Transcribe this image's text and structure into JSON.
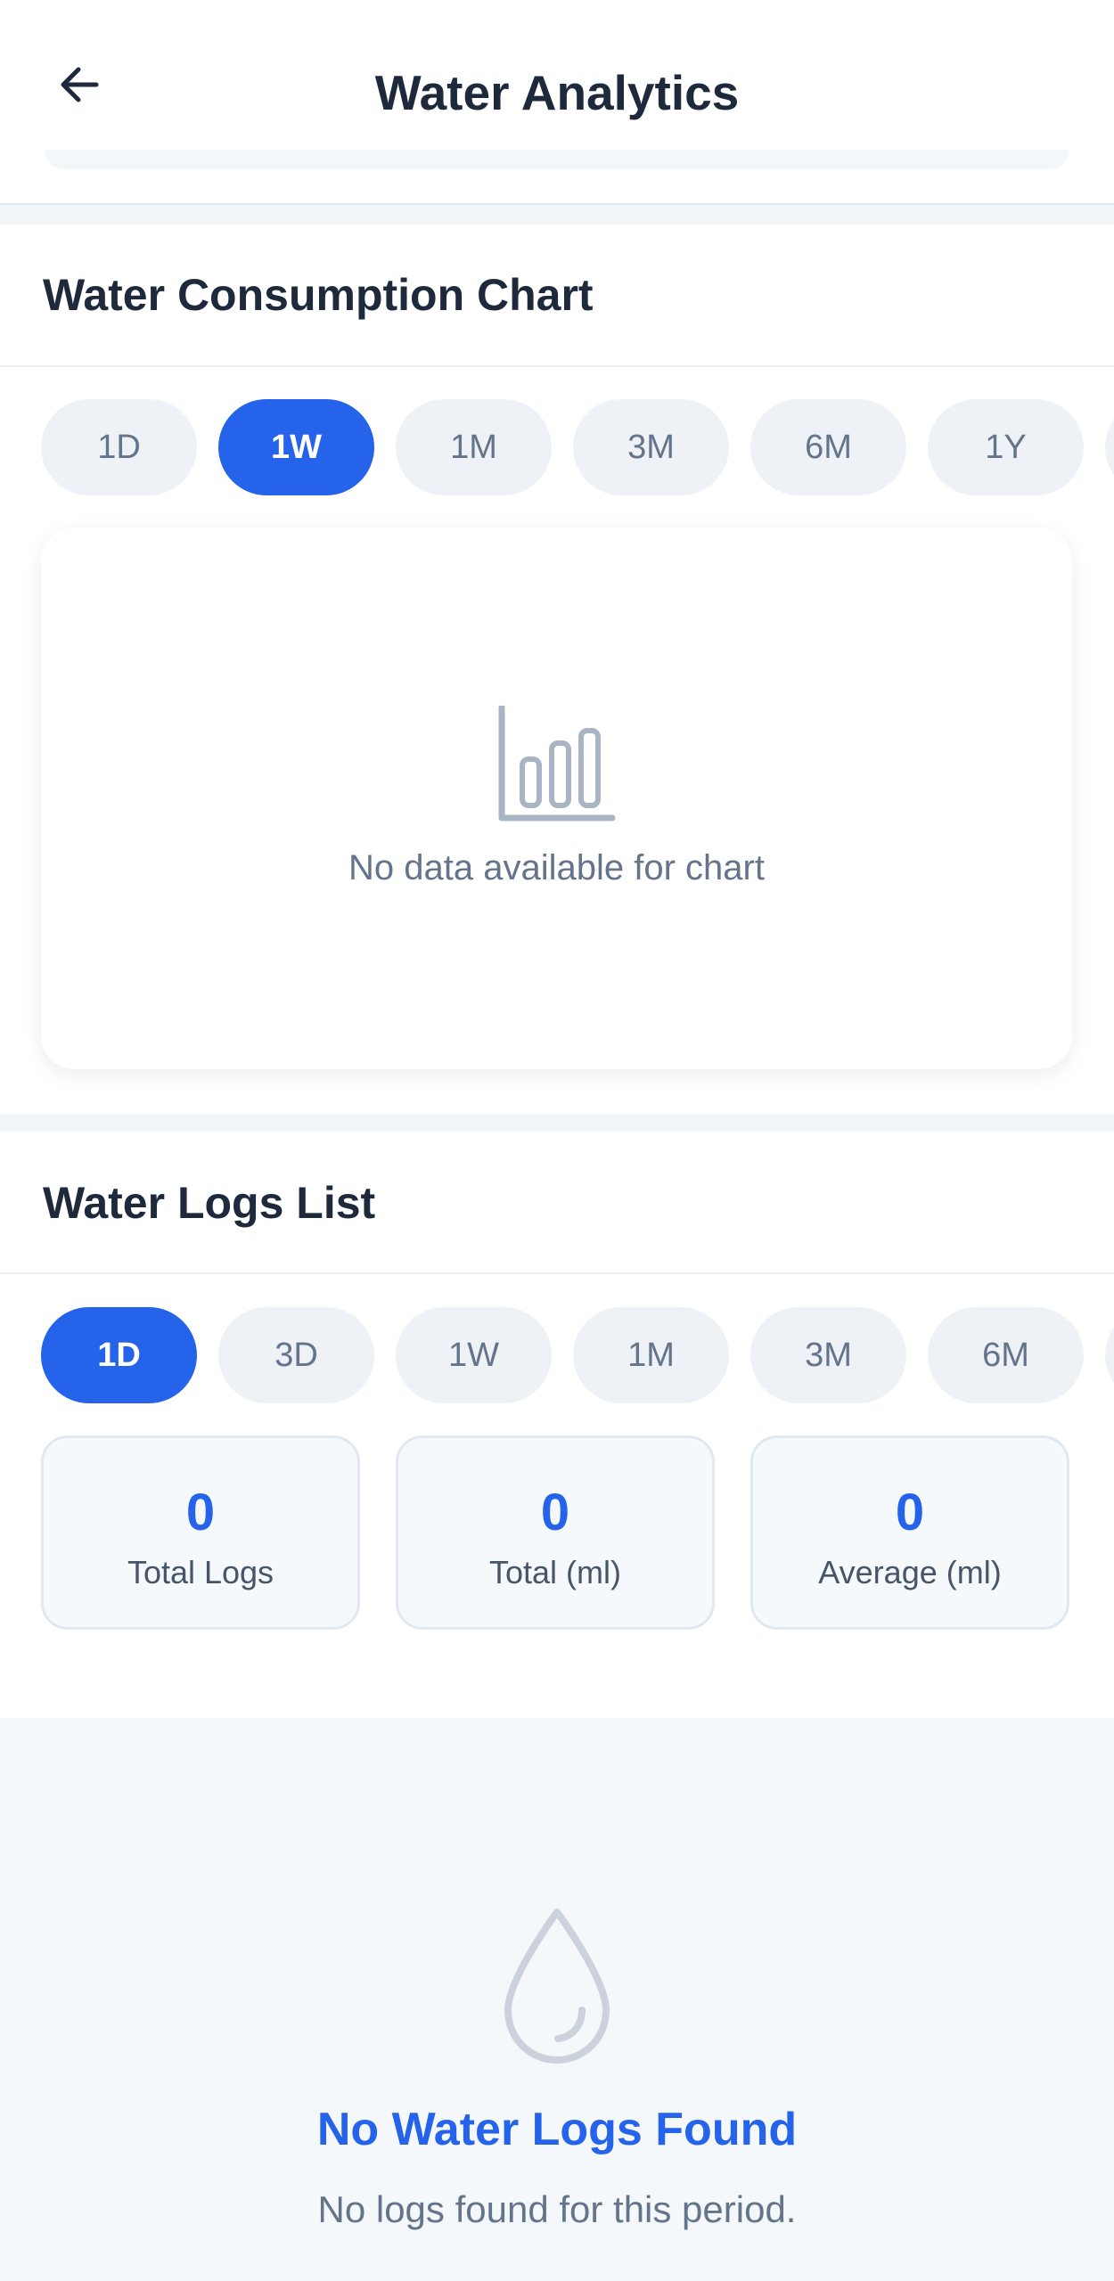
{
  "header": {
    "title": "Water Analytics",
    "back_icon": "arrow-left-icon"
  },
  "chart_section": {
    "title": "Water Consumption Chart",
    "ranges": [
      "1D",
      "1W",
      "1M",
      "3M",
      "6M",
      "1Y"
    ],
    "selected_range": "1W",
    "empty_icon": "bar-chart-icon",
    "empty_text": "No data available for chart"
  },
  "logs_section": {
    "title": "Water Logs List",
    "ranges": [
      "1D",
      "3D",
      "1W",
      "1M",
      "3M",
      "6M"
    ],
    "selected_range": "1D",
    "stats": [
      {
        "value": "0",
        "label": "Total Logs"
      },
      {
        "value": "0",
        "label": "Total (ml)"
      },
      {
        "value": "0",
        "label": "Average (ml)"
      }
    ]
  },
  "empty_state": {
    "icon": "water-drop-icon",
    "title": "No Water Logs Found",
    "subtitle": "No logs found for this period."
  },
  "colors": {
    "accent": "#2563eb",
    "text_primary": "#1e293b",
    "text_muted": "#64748b",
    "pill_bg": "#eef2f7"
  }
}
